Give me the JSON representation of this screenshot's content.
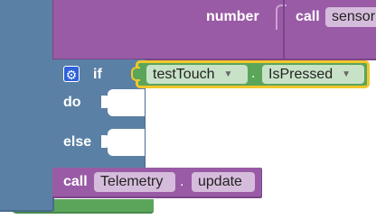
{
  "colors": {
    "outer_green": "#5ba55b",
    "outer_green_border": "#46894a",
    "loop_blue": "#5b80a5",
    "loop_blue_border": "#486a8d",
    "call_purple": "#995ba5",
    "call_purple_border": "#7b4587",
    "object_green": "#5ba55b",
    "highlight_yellow": "#f2c72b",
    "gear_blue": "#2f61d9"
  },
  "top_call_block": {
    "param_label": "number",
    "call_keyword": "call",
    "target_field": "sensor"
  },
  "if_block": {
    "mutator_icon": "gear-icon",
    "if_label": "if",
    "do_label": "do",
    "else_label": "else",
    "condition": {
      "object": "testTouch",
      "separator": ".",
      "property": "IsPressed",
      "dropdown_icon": "dropdown-arrow-icon"
    }
  },
  "telemetry_call": {
    "call_keyword": "call",
    "object": "Telemetry",
    "separator": ".",
    "method": "update"
  }
}
